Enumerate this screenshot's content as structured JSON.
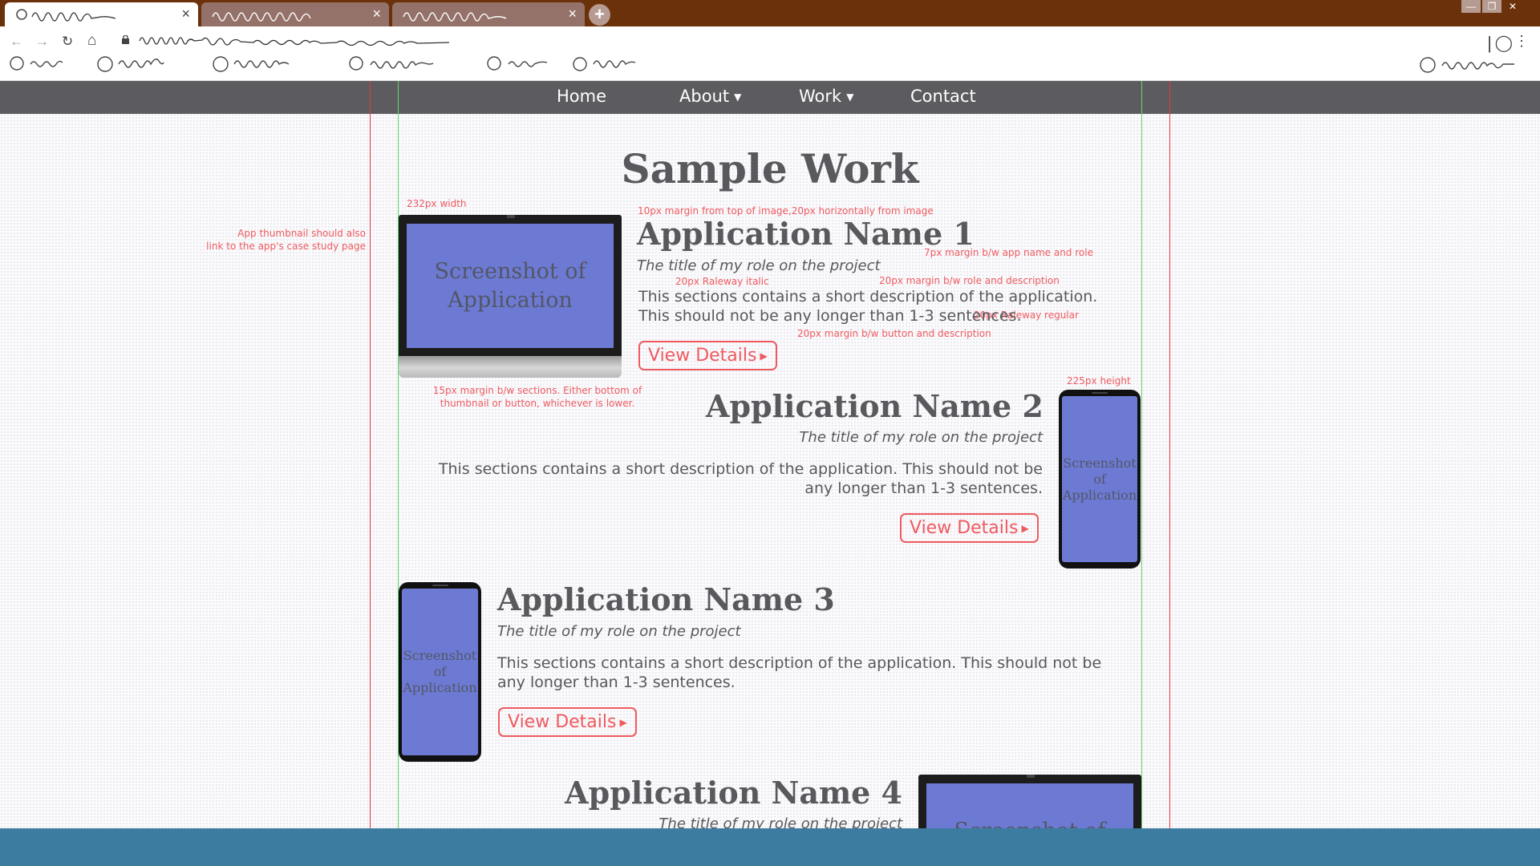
{
  "browser": {
    "new_tab_label": "+",
    "tab_close": "×",
    "window_controls": {
      "minimize": "—",
      "maximize": "❐",
      "close": "✕"
    },
    "nav": {
      "back": "←",
      "forward": "→",
      "reload": "↻",
      "home": "⌂"
    },
    "menu_glyph": "⋮",
    "extension_glyph": "◯",
    "divider_glyph": "|"
  },
  "site_nav": {
    "items": [
      {
        "label": "Home",
        "caret": ""
      },
      {
        "label": "About",
        "caret": "▼"
      },
      {
        "label": "Work",
        "caret": "▼"
      },
      {
        "label": "Contact",
        "caret": ""
      }
    ]
  },
  "page": {
    "title": "Sample Work",
    "thumbnail_placeholder": "Screenshot of Application",
    "button_arrow": "▶"
  },
  "annotations": {
    "width_note": "232px width",
    "link_note_line1": "App thumbnail should also",
    "link_note_line2": "link to the app's case study page",
    "margin_top_note": "10px margin from top of image,20px horizontally from image",
    "name_role_note": "7px margin b/w app name and role",
    "italic_note": "20px Raleway italic",
    "role_desc_note": "20px margin b/w role and description",
    "regular_note": "20px Raleway regular",
    "button_desc_note": "20px margin b/w button and description",
    "sections_note_line1": "15px margin b/w sections. Either bottom of",
    "sections_note_line2": "thumbnail or button, whichever is lower.",
    "height_note": "225px height"
  },
  "apps": [
    {
      "name": "Application Name 1",
      "role": "The title of my role on the project",
      "desc": "This sections contains a short description of the application. This should not be any longer than 1-3 sentences.",
      "button": "View Details",
      "device": "laptop"
    },
    {
      "name": "Application Name 2",
      "role": "The title of my role on the project",
      "desc": "This sections contains a short description of the application. This should not be any longer than 1-3 sentences.",
      "button": "View Details",
      "device": "phone"
    },
    {
      "name": "Application Name 3",
      "role": "The title of my role on the project",
      "desc": "This sections contains a short description of the application. This should not be any longer than 1-3 sentences.",
      "button": "View Details",
      "device": "phone"
    },
    {
      "name": "Application Name 4",
      "role": "The title of my role on the project",
      "device": "laptop"
    }
  ],
  "colors": {
    "tabbar": "#6b310a",
    "site_nav": "#5c5c60",
    "accent": "#ef5a5f",
    "screen": "#6d7ad3",
    "footer": "#3c7ca0",
    "guide_red": "#e6363c",
    "guide_green": "#66d466"
  }
}
